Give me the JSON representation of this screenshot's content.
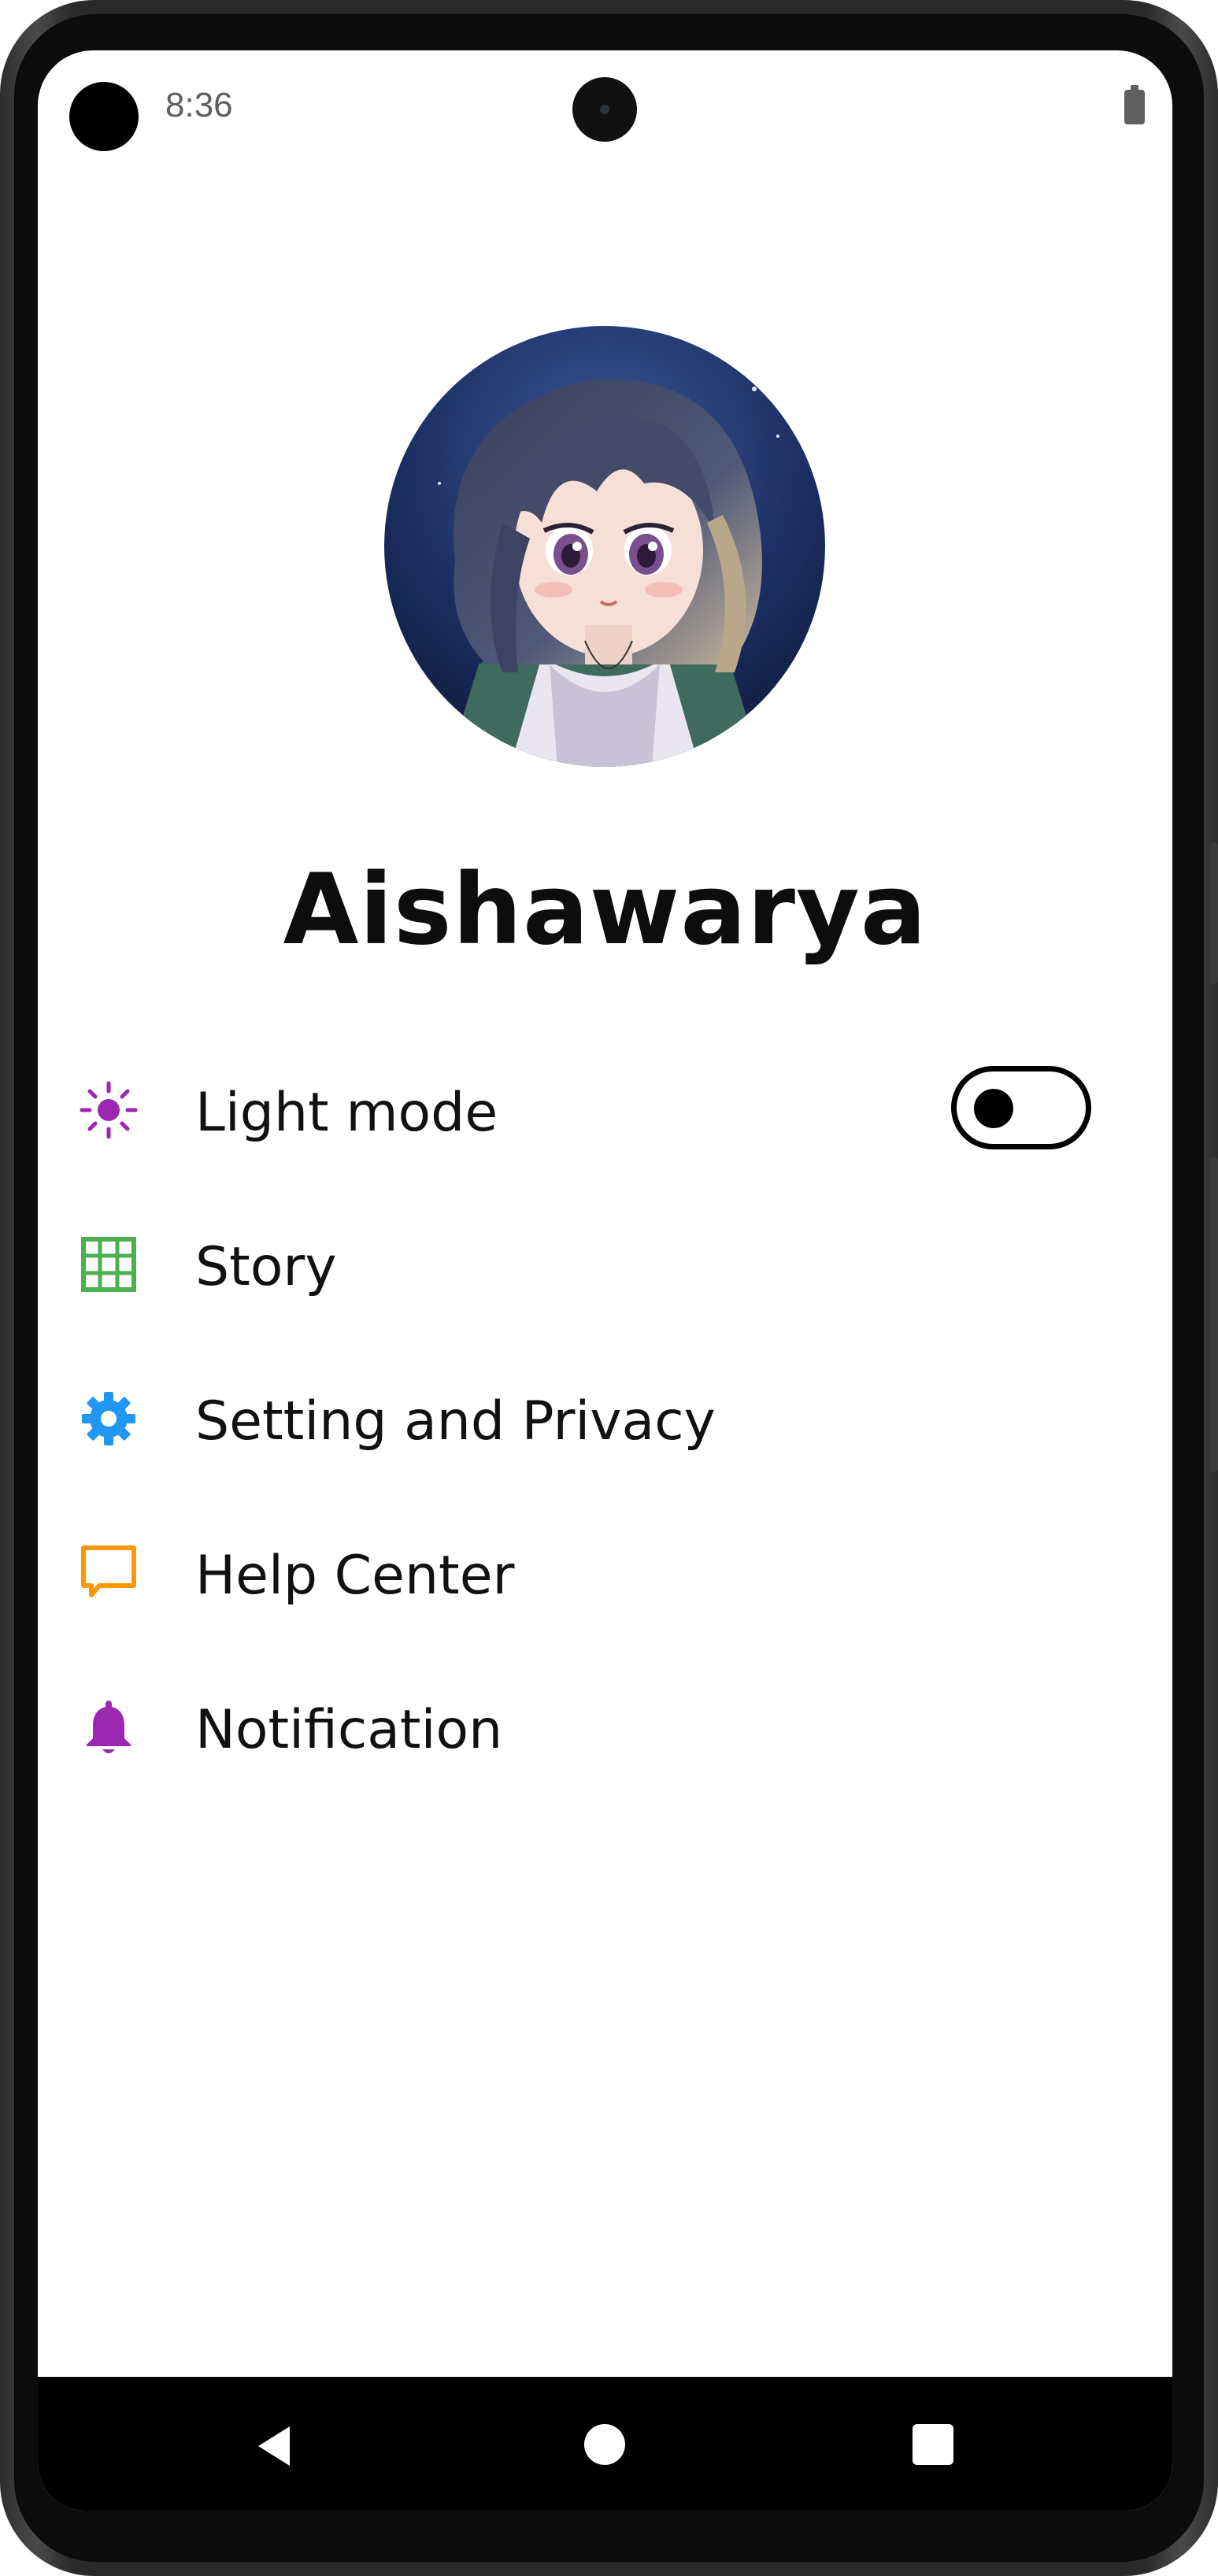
{
  "status_bar": {
    "time": "8:36"
  },
  "profile": {
    "name": "Aishawarya",
    "avatar_icon": "anime-girl-avatar"
  },
  "menu": {
    "items": [
      {
        "label": "Light mode",
        "icon": "sun-icon",
        "icon_color": "#9c27b0",
        "has_toggle": true,
        "toggle_on": false
      },
      {
        "label": "Story",
        "icon": "grid-icon",
        "icon_color": "#4caf50"
      },
      {
        "label": "Setting and Privacy",
        "icon": "gear-icon",
        "icon_color": "#2196f3"
      },
      {
        "label": "Help Center",
        "icon": "chat-bubble-icon",
        "icon_color": "#ff9800"
      },
      {
        "label": "Notification",
        "icon": "bell-icon",
        "icon_color": "#9c27b0"
      }
    ]
  },
  "nav_bar": {
    "buttons": [
      "back",
      "home",
      "recents"
    ]
  },
  "colors": {
    "background": "#ffffff",
    "text": "#111111",
    "nav_bar": "#000000"
  }
}
